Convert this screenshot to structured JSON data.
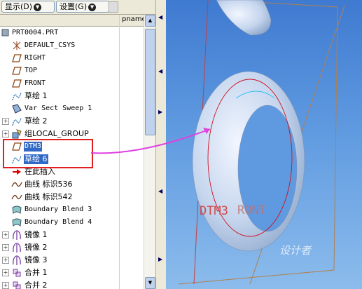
{
  "toolbar": {
    "display_label": "显示",
    "display_key": "(D)",
    "settings_label": "设置",
    "settings_key": "(G)"
  },
  "header": {
    "column": "pname"
  },
  "tree": {
    "items": [
      {
        "label": "PRT0004.PRT",
        "icon": "part-icon",
        "cn": false
      },
      {
        "label": "DEFAULT_CSYS",
        "icon": "csys-icon",
        "cn": false
      },
      {
        "label": "RIGHT",
        "icon": "datum-plane-icon",
        "cn": false
      },
      {
        "label": "TOP",
        "icon": "datum-plane-icon",
        "cn": false
      },
      {
        "label": "FRONT",
        "icon": "datum-plane-icon",
        "cn": false
      },
      {
        "label": "草绘 1",
        "icon": "sketch-icon",
        "cn": true
      },
      {
        "label": "Var Sect Sweep 1",
        "icon": "sweep-icon",
        "cn": false
      },
      {
        "label": "草绘 2",
        "icon": "sketch-icon",
        "cn": true
      },
      {
        "label": "组LOCAL_GROUP",
        "icon": "group-icon",
        "cn": true
      },
      {
        "label": "DTM3",
        "icon": "datum-plane-icon",
        "cn": false
      },
      {
        "label": "草绘 6",
        "icon": "sketch-icon",
        "cn": true
      },
      {
        "label": "在此插入",
        "icon": "insert-here-icon",
        "cn": true
      },
      {
        "label": "曲线 标识536",
        "icon": "curve-icon",
        "cn": true
      },
      {
        "label": "曲线 标识542",
        "icon": "curve-icon",
        "cn": true
      },
      {
        "label": "Boundary Blend 3",
        "icon": "boundary-blend-icon",
        "cn": false
      },
      {
        "label": "Boundary Blend 4",
        "icon": "boundary-blend-icon",
        "cn": false
      },
      {
        "label": "镜像 1",
        "icon": "mirror-icon",
        "cn": true
      },
      {
        "label": "镜像 2",
        "icon": "mirror-icon",
        "cn": true
      },
      {
        "label": "镜像 3",
        "icon": "mirror-icon",
        "cn": true
      },
      {
        "label": "合并 1",
        "icon": "merge-icon",
        "cn": true
      },
      {
        "label": "合并 2",
        "icon": "merge-icon",
        "cn": true
      }
    ]
  },
  "viewport": {
    "datum_label": "DTM3",
    "front_label": "RONT",
    "watermark": "设计者"
  },
  "colors": {
    "selection": "#316ac5",
    "highlight_box": "#e02020",
    "arrow": "#e040e0",
    "background": "#5f9ae0"
  }
}
